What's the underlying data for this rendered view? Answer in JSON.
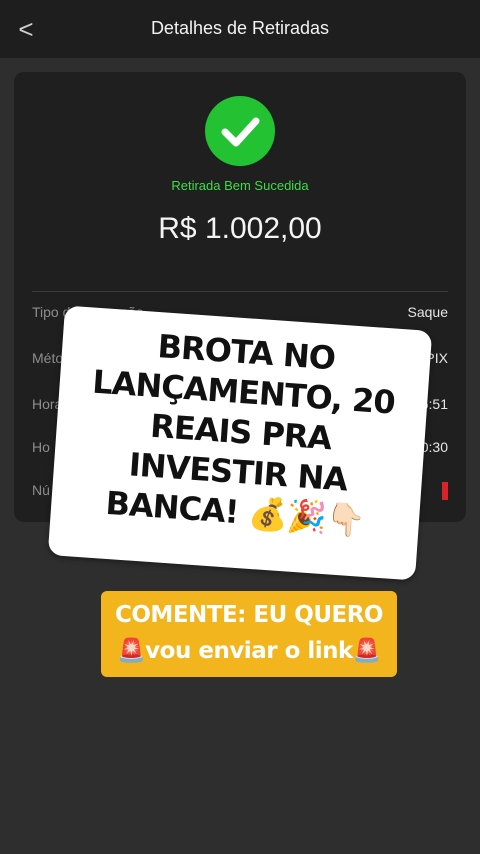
{
  "header": {
    "back_glyph": "<",
    "title": "Detalhes de Retiradas"
  },
  "card": {
    "status": "Retirada Bem Sucedida",
    "amount": "R$ 1.002,00",
    "rows": [
      {
        "label": "Tipo de transação",
        "value": "Saque"
      },
      {
        "label": "Método de Retiro",
        "value": "PIX",
        "icon": "pix-icon"
      },
      {
        "label": "Hora de",
        "value": "6:51"
      },
      {
        "label": "Ho",
        "value": "0:30"
      },
      {
        "label": "Nú",
        "value": ""
      }
    ]
  },
  "overlay": {
    "text": "BROTA NO LANÇAMENTO, 20 REAIS PRA INVESTIR NA BANCA! 💰🎉👇🏻"
  },
  "cta": {
    "line1": "COMENTE: EU QUERO",
    "line2": "🚨vou enviar o link🚨"
  },
  "colors": {
    "success_green": "#22c233",
    "status_text_green": "#3fdc4a",
    "cta_yellow": "#f2b51e",
    "background": "#2e2e2e",
    "card": "#1f1f1f"
  }
}
